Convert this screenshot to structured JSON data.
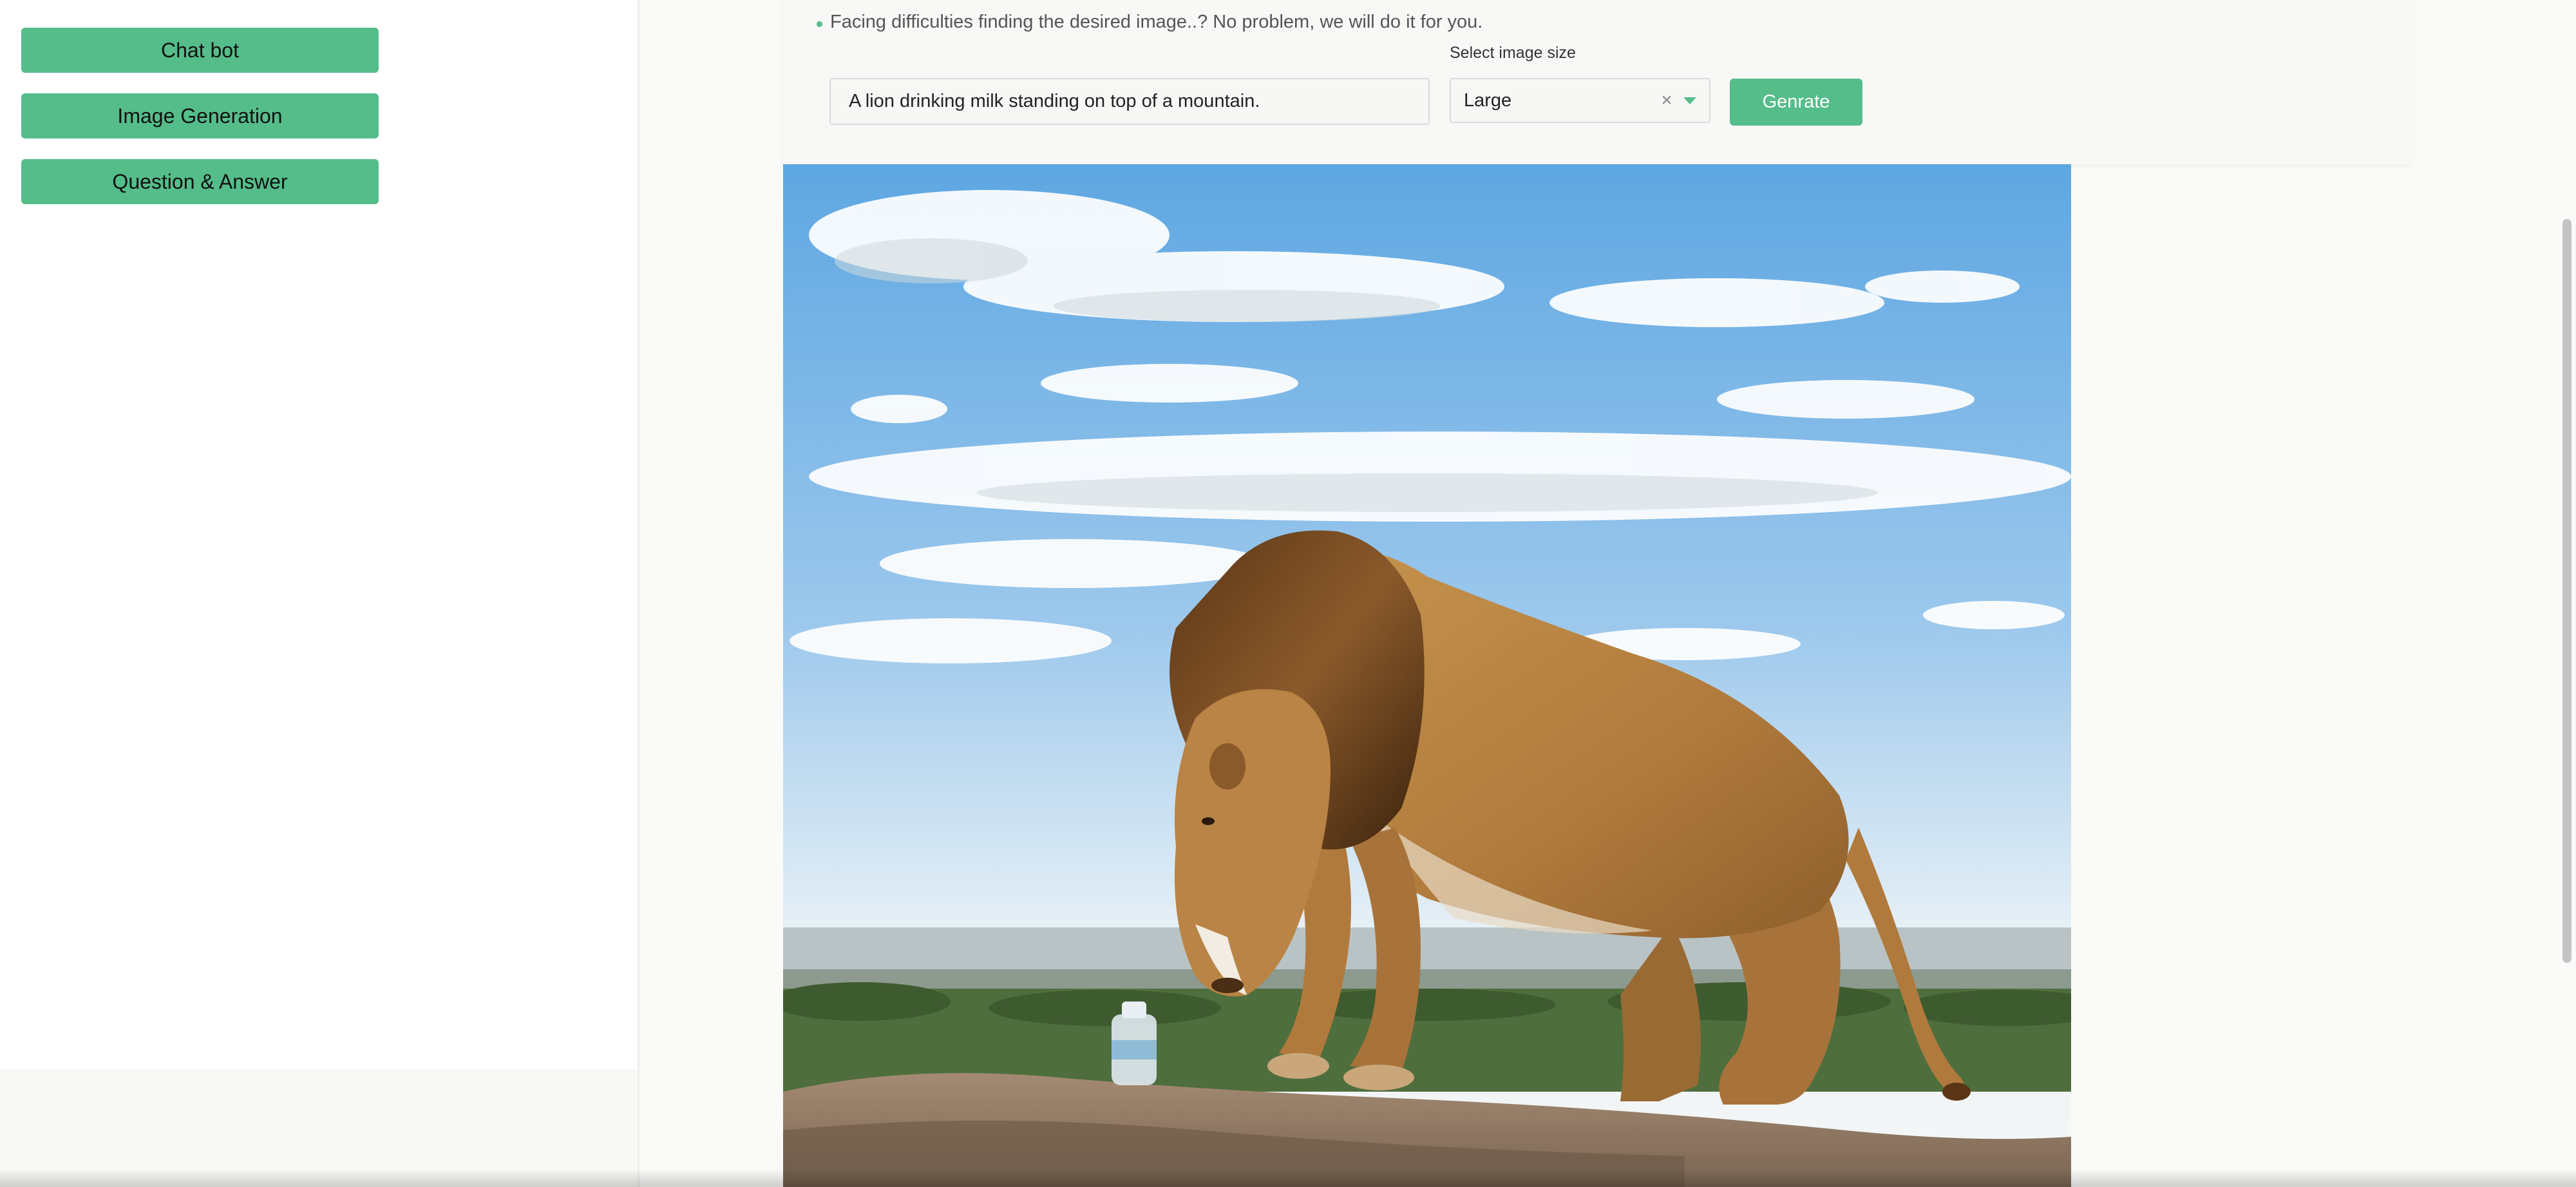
{
  "sidebar": {
    "items": [
      {
        "label": "Chat bot"
      },
      {
        "label": "Image Generation"
      },
      {
        "label": "Question & Answer"
      }
    ]
  },
  "form": {
    "tip": "Facing difficulties finding the desired image..? No problem, we will do it for you.",
    "prompt_value": "A lion drinking milk standing on top of a mountain.",
    "size_label": "Select image size",
    "size_value": "Large",
    "generate_label": "Genrate"
  },
  "colors": {
    "accent": "#55bd8a",
    "background": "#fafaf8"
  },
  "icons": {
    "clear": "close-icon",
    "dropdown": "chevron-down-icon",
    "bullet": "bullet-icon"
  }
}
